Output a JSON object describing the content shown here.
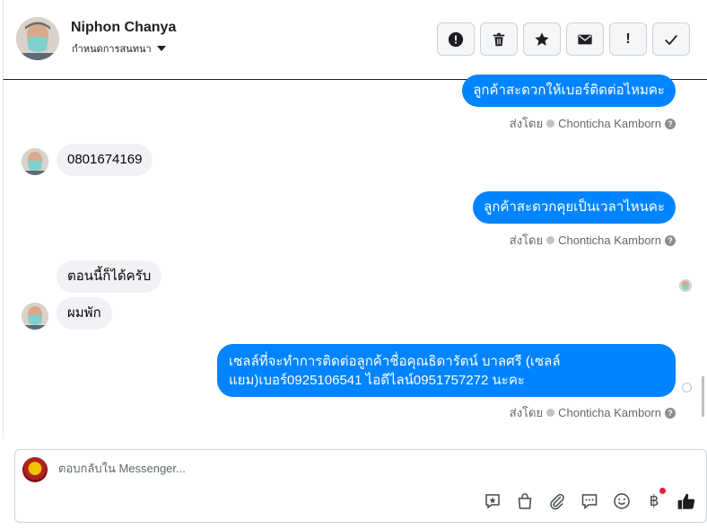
{
  "header": {
    "name": "Niphon Chanya",
    "subtitle": "กำหนดการสนทนา"
  },
  "actions": [
    {
      "icon": "alert-circle-icon",
      "label": "!"
    },
    {
      "icon": "trash-icon"
    },
    {
      "icon": "star-icon"
    },
    {
      "icon": "envelope-icon"
    },
    {
      "icon": "exclamation-icon",
      "label": "!"
    },
    {
      "icon": "checkmark-icon"
    }
  ],
  "messages": [
    {
      "side": "out",
      "text": "ลูกค้าสะดวกให้เบอร์ติดต่อไหมคะ"
    },
    {
      "side": "in",
      "text": "0801674169"
    },
    {
      "side": "out",
      "text": "ลูกค้าสะดวกคุยเป็นเวลาไหนคะ"
    },
    {
      "side": "in",
      "text": "ตอนนี้ก็ได้ครับ"
    },
    {
      "side": "in",
      "text": "ผมพัก"
    },
    {
      "side": "out",
      "line1": "เซลล์ที่จะทำการติดต่อลูกค้าชื่อคุณธิดารัตน์ บาลศรี (เซลล์",
      "line2": "แยม)เบอร์0925106541 ไอดีไลน์0951757272 นะคะ"
    }
  ],
  "sent_by": {
    "label": "ส่งโดย",
    "agent": "Chonticha Kamborn",
    "help": "?"
  },
  "composer": {
    "placeholder": "ตอบกลับใน Messenger...",
    "tools": [
      "saved-reply-icon",
      "shopping-bag-icon",
      "paperclip-icon",
      "chat-bubble-icon",
      "emoji-icon",
      "baht-payment-icon",
      "thumbs-up-icon"
    ],
    "baht_symbol": "฿"
  },
  "colors": {
    "outgoing_bubble": "#0084ff",
    "incoming_bubble": "#f0f2f5",
    "like_button": "#1c1e21",
    "notification_dot": "#e41e3f"
  }
}
